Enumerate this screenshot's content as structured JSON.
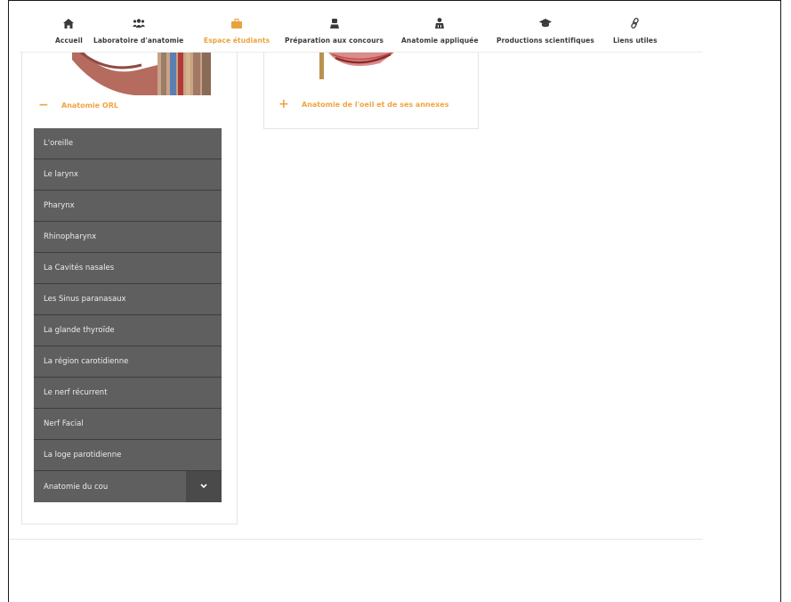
{
  "nav": {
    "items": [
      {
        "label": "Accueil",
        "icon": "home-icon"
      },
      {
        "label": "Laboratoire d'anatomie",
        "icon": "users-icon"
      },
      {
        "label": "Espace étudiants",
        "icon": "briefcase-icon",
        "active": true
      },
      {
        "label": "Préparation aux concours",
        "icon": "user-tie-icon"
      },
      {
        "label": "Anatomie appliquée",
        "icon": "user-doctor-icon"
      },
      {
        "label": "Productions scientifiques",
        "icon": "graduation-cap-icon"
      },
      {
        "label": "Liens utiles",
        "icon": "link-icon"
      }
    ]
  },
  "left_card": {
    "title": "Anatomie ORL",
    "toggle": "−",
    "menu": [
      "L'oreille",
      "Le larynx",
      "Pharynx",
      "Rhinopharynx",
      "La Cavités nasales",
      "Les Sinus paranasaux",
      "La glande thyroïde",
      "La région carotidienne",
      "Le nerf récurrent",
      "Nerf Facial",
      "La loge parotidienne",
      "Anatomie du cou"
    ]
  },
  "mid_card": {
    "title": "Anatomie de l'oeil et de ses annexes",
    "toggle": "+"
  },
  "colors": {
    "accent": "#f0a441",
    "menu_bg": "#5f5f5f",
    "menu_border": "#3e3e3e",
    "nav_text": "#3a3a3a"
  }
}
